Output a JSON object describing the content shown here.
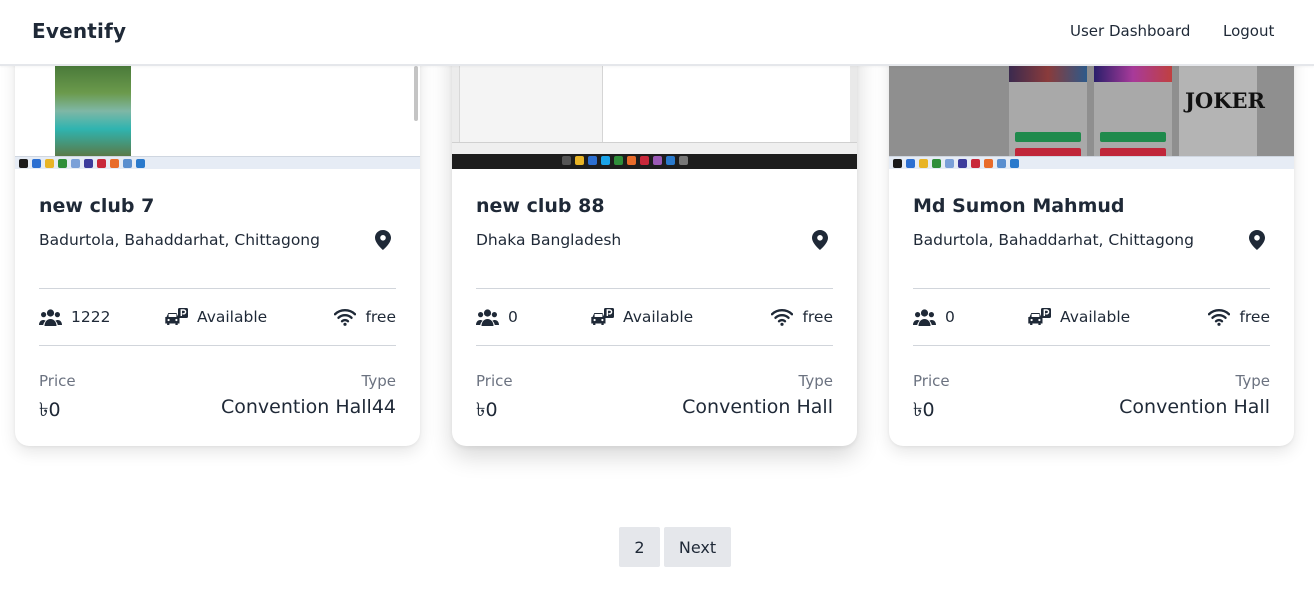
{
  "header": {
    "brand": "Eventify",
    "nav": {
      "dashboard": "User Dashboard",
      "logout": "Logout"
    }
  },
  "cards": [
    {
      "title": "new club 7",
      "location": "Badurtola, Bahaddarhat, Chittagong",
      "capacity": "1222",
      "parking": "Available",
      "wifi": "free",
      "price_label": "Price",
      "price": "৳0",
      "type_label": "Type",
      "type": "Convention Hall44"
    },
    {
      "title": "new club 88",
      "location": "Dhaka Bangladesh",
      "capacity": "0",
      "parking": "Available",
      "wifi": "free",
      "price_label": "Price",
      "price": "৳0",
      "type_label": "Type",
      "type": "Convention Hall"
    },
    {
      "title": "Md Sumon Mahmud",
      "location": "Badurtola, Bahaddarhat, Chittagong",
      "capacity": "0",
      "parking": "Available",
      "wifi": "free",
      "price_label": "Price",
      "price": "৳0",
      "type_label": "Type",
      "type": "Convention Hall"
    }
  ],
  "card3_thumb_text": "JOKER",
  "pagination": {
    "page": "2",
    "next": "Next"
  },
  "icons": [
    "location-pin-icon",
    "users-icon",
    "car-parking-icon",
    "wifi-icon"
  ],
  "colors": {
    "text": "#1f2937",
    "muted": "#6b7280",
    "divider": "#d1d5db",
    "pagination_bg": "#e5e7eb"
  }
}
